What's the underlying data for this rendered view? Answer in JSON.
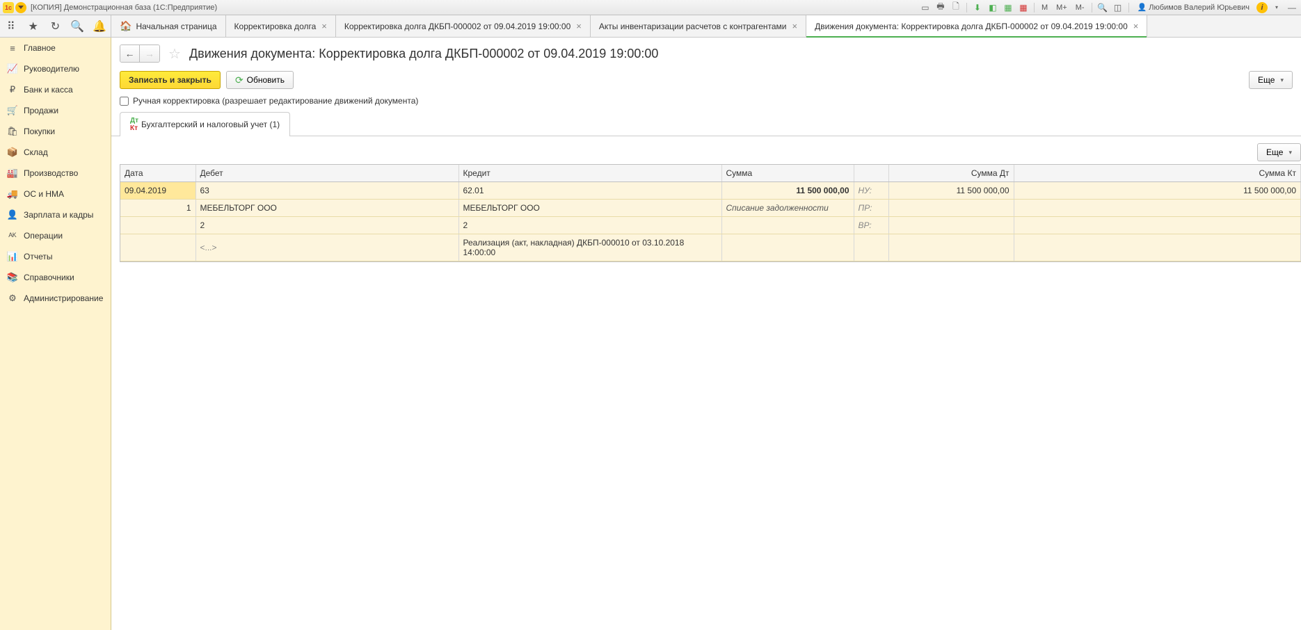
{
  "titlebar": {
    "app_title": "[КОПИЯ] Демонстрационная база  (1С:Предприятие)",
    "user_name": "Любимов Валерий Юрьевич",
    "m_labels": [
      "M",
      "M+",
      "M-"
    ]
  },
  "toptabs": {
    "home": "Начальная страница",
    "tabs": [
      {
        "label": "Корректировка долга"
      },
      {
        "label": "Корректировка долга ДКБП-000002 от 09.04.2019 19:00:00"
      },
      {
        "label": "Акты инвентаризации расчетов с контрагентами"
      },
      {
        "label": "Движения документа: Корректировка долга ДКБП-000002 от 09.04.2019 19:00:00",
        "active": true
      }
    ]
  },
  "sidebar": {
    "items": [
      {
        "icon": "≡",
        "label": "Главное"
      },
      {
        "icon": "📈",
        "label": "Руководителю"
      },
      {
        "icon": "₽",
        "label": "Банк и касса"
      },
      {
        "icon": "🛒",
        "label": "Продажи"
      },
      {
        "icon": "🛍",
        "label": "Покупки"
      },
      {
        "icon": "📦",
        "label": "Склад"
      },
      {
        "icon": "🏭",
        "label": "Производство"
      },
      {
        "icon": "🚚",
        "label": "ОС и НМА"
      },
      {
        "icon": "👤",
        "label": "Зарплата и кадры"
      },
      {
        "icon": "ᴬᴷ",
        "label": "Операции"
      },
      {
        "icon": "📊",
        "label": "Отчеты"
      },
      {
        "icon": "📚",
        "label": "Справочники"
      },
      {
        "icon": "⚙",
        "label": "Администрирование"
      }
    ]
  },
  "header": {
    "title": "Движения документа: Корректировка долга ДКБП-000002 от 09.04.2019 19:00:00"
  },
  "commands": {
    "save_close": "Записать и закрыть",
    "refresh": "Обновить",
    "more": "Еще"
  },
  "checkbox": {
    "label": "Ручная корректировка (разрешает редактирование движений документа)"
  },
  "inner_tab": {
    "label": "Бухгалтерский и налоговый учет (1)"
  },
  "grid": {
    "headers": {
      "date": "Дата",
      "debit": "Дебет",
      "credit": "Кредит",
      "sum": "Сумма",
      "sum_dt": "Сумма Дт",
      "sum_kt": "Сумма Кт"
    },
    "row": {
      "date": "09.04.2019",
      "seq": "1",
      "debit_acc": "63",
      "debit_party": "МЕБЕЛЬТОРГ ООО",
      "debit_dim2": "2",
      "debit_dim3": "<...>",
      "credit_acc": "62.01",
      "credit_party": "МЕБЕЛЬТОРГ ООО",
      "credit_dim2": "2",
      "credit_dim3": "Реализация (акт, накладная) ДКБП-000010 от 03.10.2018 14:00:00",
      "sum": "11 500 000,00",
      "sum_note": "Списание задолженности",
      "ind_nu": "НУ:",
      "ind_pr": "ПР:",
      "ind_vr": "ВР:",
      "sum_dt": "11 500 000,00",
      "sum_kt": "11 500 000,00"
    }
  }
}
